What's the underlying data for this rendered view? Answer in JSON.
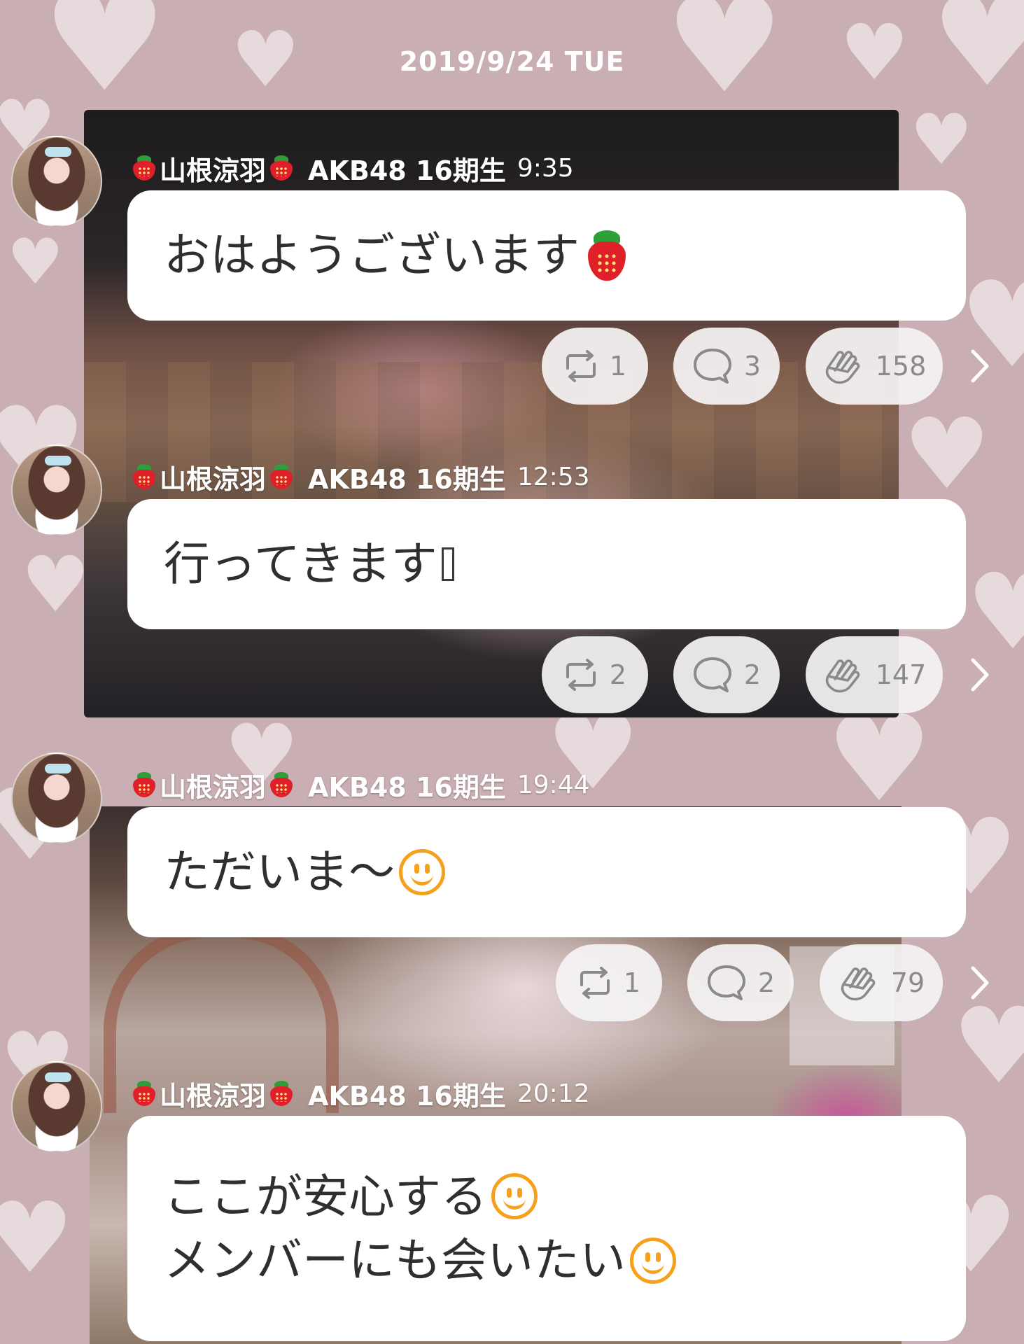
{
  "date_header": "2019/9/24 TUE",
  "posts": [
    {
      "author": "山根涼羽",
      "group": "AKB48 16期生",
      "time": "9:35",
      "lines": [
        "おはようございます"
      ],
      "retweets": "1",
      "comments": "3",
      "claps": "158"
    },
    {
      "author": "山根涼羽",
      "group": "AKB48 16期生",
      "time": "12:53",
      "lines": [
        "行ってきます"
      ],
      "retweets": "2",
      "comments": "2",
      "claps": "147"
    },
    {
      "author": "山根涼羽",
      "group": "AKB48 16期生",
      "time": "19:44",
      "lines": [
        "ただいま〜"
      ],
      "retweets": "1",
      "comments": "2",
      "claps": "79"
    },
    {
      "author": "山根涼羽",
      "group": "AKB48 16期生",
      "time": "20:12",
      "lines": [
        "ここが安心する",
        "メンバーにも会いたい"
      ]
    }
  ],
  "icons": {
    "retweet": "retweet-icon",
    "comment": "comment-icon",
    "clap": "clap-icon",
    "chevron": "chevron-right-icon",
    "strawberry": "strawberry-icon",
    "smile": "smile-icon"
  },
  "colors": {
    "background": "#c9aeb3",
    "bubble": "#ffffff",
    "pill": "#f5f3f4",
    "strawberry": "#e01f2a",
    "smile": "#f5a11d"
  }
}
